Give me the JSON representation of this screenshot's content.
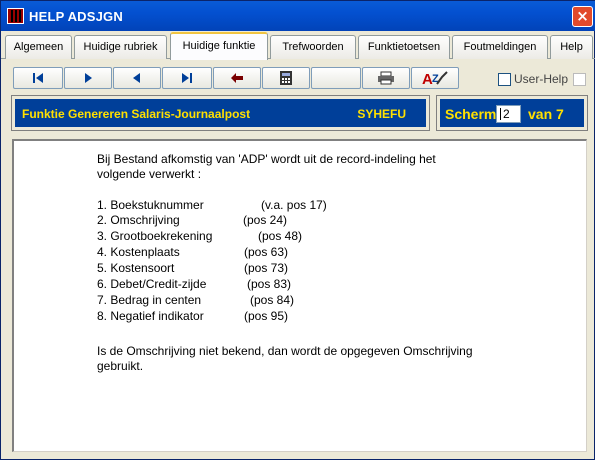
{
  "window": {
    "title": "HELP ADSJGN",
    "close_label": "×"
  },
  "tabs": [
    {
      "label": "Algemeen",
      "active": false
    },
    {
      "label": "Huidige rubriek",
      "active": false
    },
    {
      "label": "Huidige funktie",
      "active": true
    },
    {
      "label": "Trefwoorden",
      "active": false
    },
    {
      "label": "Funktietoetsen",
      "active": false
    },
    {
      "label": "Foutmeldingen",
      "active": false
    },
    {
      "label": "Help",
      "active": false
    }
  ],
  "toolbar": {
    "buttons": [
      {
        "icon": "first-page-icon"
      },
      {
        "icon": "play-forward-icon"
      },
      {
        "icon": "play-back-icon"
      },
      {
        "icon": "last-page-icon"
      },
      {
        "icon": "return-arrow-icon"
      },
      {
        "icon": "calculator-icon"
      },
      {
        "icon": "blank"
      },
      {
        "icon": "printer-icon"
      },
      {
        "icon": "spell-check-icon"
      }
    ],
    "user_help_label": "User-Help",
    "user_help_checked": false
  },
  "header": {
    "function_title": "Funktie Genereren Salaris-Journaalpost",
    "function_code": "SYHEFU",
    "screen_label": "Scherm",
    "screen_value": "2",
    "screen_total_label": "van 7"
  },
  "content": {
    "intro_line1": "Bij Bestand afkomstig van 'ADP' wordt uit de record-indeling het",
    "intro_line2": "volgende verwerkt :",
    "items": [
      {
        "label": "1. Boekstuknummer",
        "pos": "(v.a. pos 17)"
      },
      {
        "label": "2. Omschrijving",
        "pos": "(pos 24)"
      },
      {
        "label": "3. Grootboekrekening",
        "pos": "(pos 48)"
      },
      {
        "label": "4. Kostenplaats",
        "pos": "(pos 63)"
      },
      {
        "label": "5. Kostensoort",
        "pos": "(pos 73)"
      },
      {
        "label": "6. Debet/Credit-zijde",
        "pos": "(pos 83)"
      },
      {
        "label": "7. Bedrag in centen",
        "pos": "(pos 84)"
      },
      {
        "label": "8. Negatief indikator",
        "pos": "(pos 95)"
      }
    ],
    "footer_line1": "Is de Omschrijving niet bekend, dan wordt de opgegeven Omschrijving",
    "footer_line2": "gebruikt."
  },
  "colors": {
    "header_bg": "#003f99",
    "header_text": "#ffe000",
    "titlebar": "#0350d0"
  }
}
